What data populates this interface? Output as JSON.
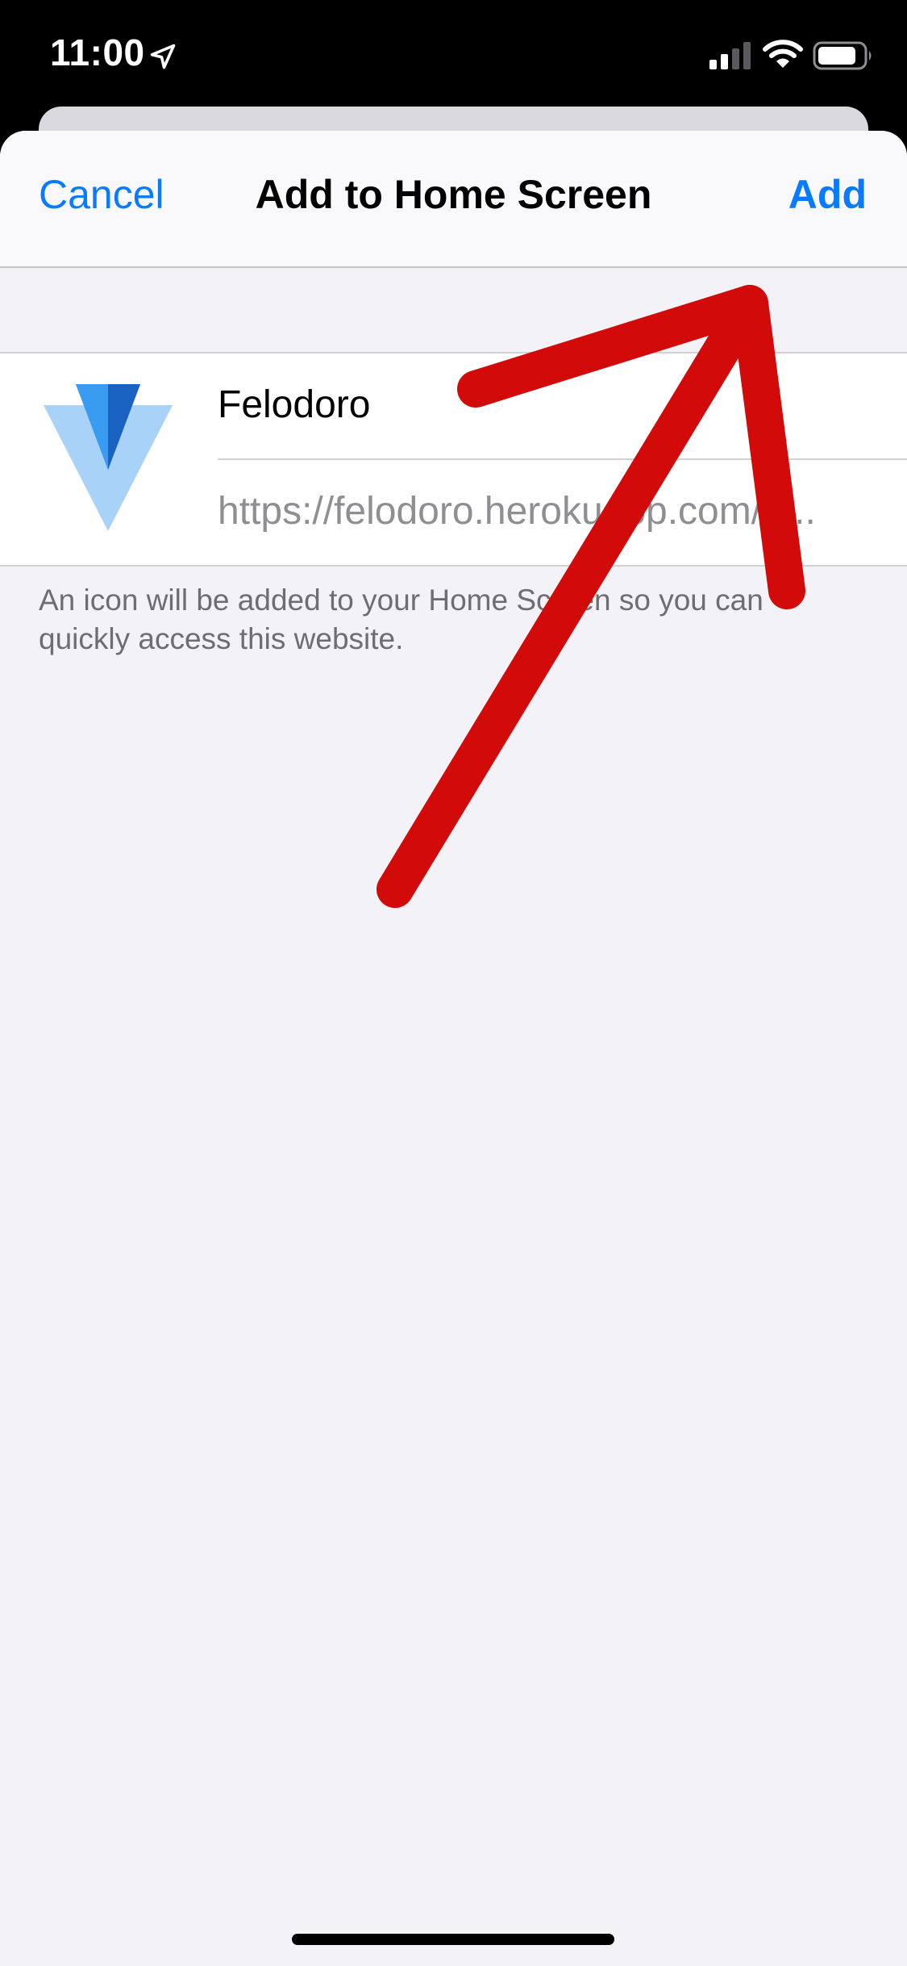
{
  "status_bar": {
    "time": "11:00",
    "icons": [
      "location-arrow-icon",
      "cellular-signal-icon",
      "wifi-icon",
      "battery-icon"
    ]
  },
  "navbar": {
    "cancel_label": "Cancel",
    "title": "Add to Home Screen",
    "add_label": "Add"
  },
  "bookmark": {
    "icon": "felodoro-app-icon",
    "name": "Felodoro",
    "url": "https://felodoro.herokuapp.com/?..."
  },
  "footnote": "An icon will be added to your Home Screen so you can quickly access this website.",
  "colors": {
    "accent": "#0a7aff",
    "annotation": "#d20a0a",
    "background": "#f2f2f7"
  }
}
